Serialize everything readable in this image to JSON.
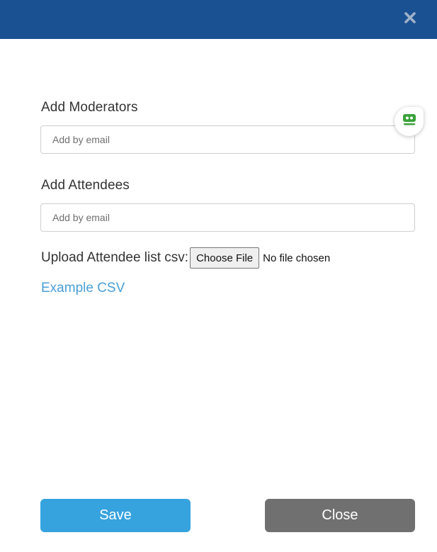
{
  "dialog": {
    "close_icon": "close-icon",
    "header_color": "#1a5192"
  },
  "moderators": {
    "label": "Add Moderators",
    "placeholder": "Add by email",
    "value": ""
  },
  "attendees": {
    "label": "Add Attendees",
    "placeholder": "Add by email",
    "value": ""
  },
  "upload": {
    "label": "Upload Attendee list csv:",
    "button_label": "Choose File",
    "status": "No file chosen"
  },
  "example_link": "Example CSV",
  "widget": {
    "icon": "robot-icon"
  },
  "footer": {
    "save_label": "Save",
    "close_label": "Close",
    "save_color": "#36a3df",
    "close_color": "#707070"
  }
}
